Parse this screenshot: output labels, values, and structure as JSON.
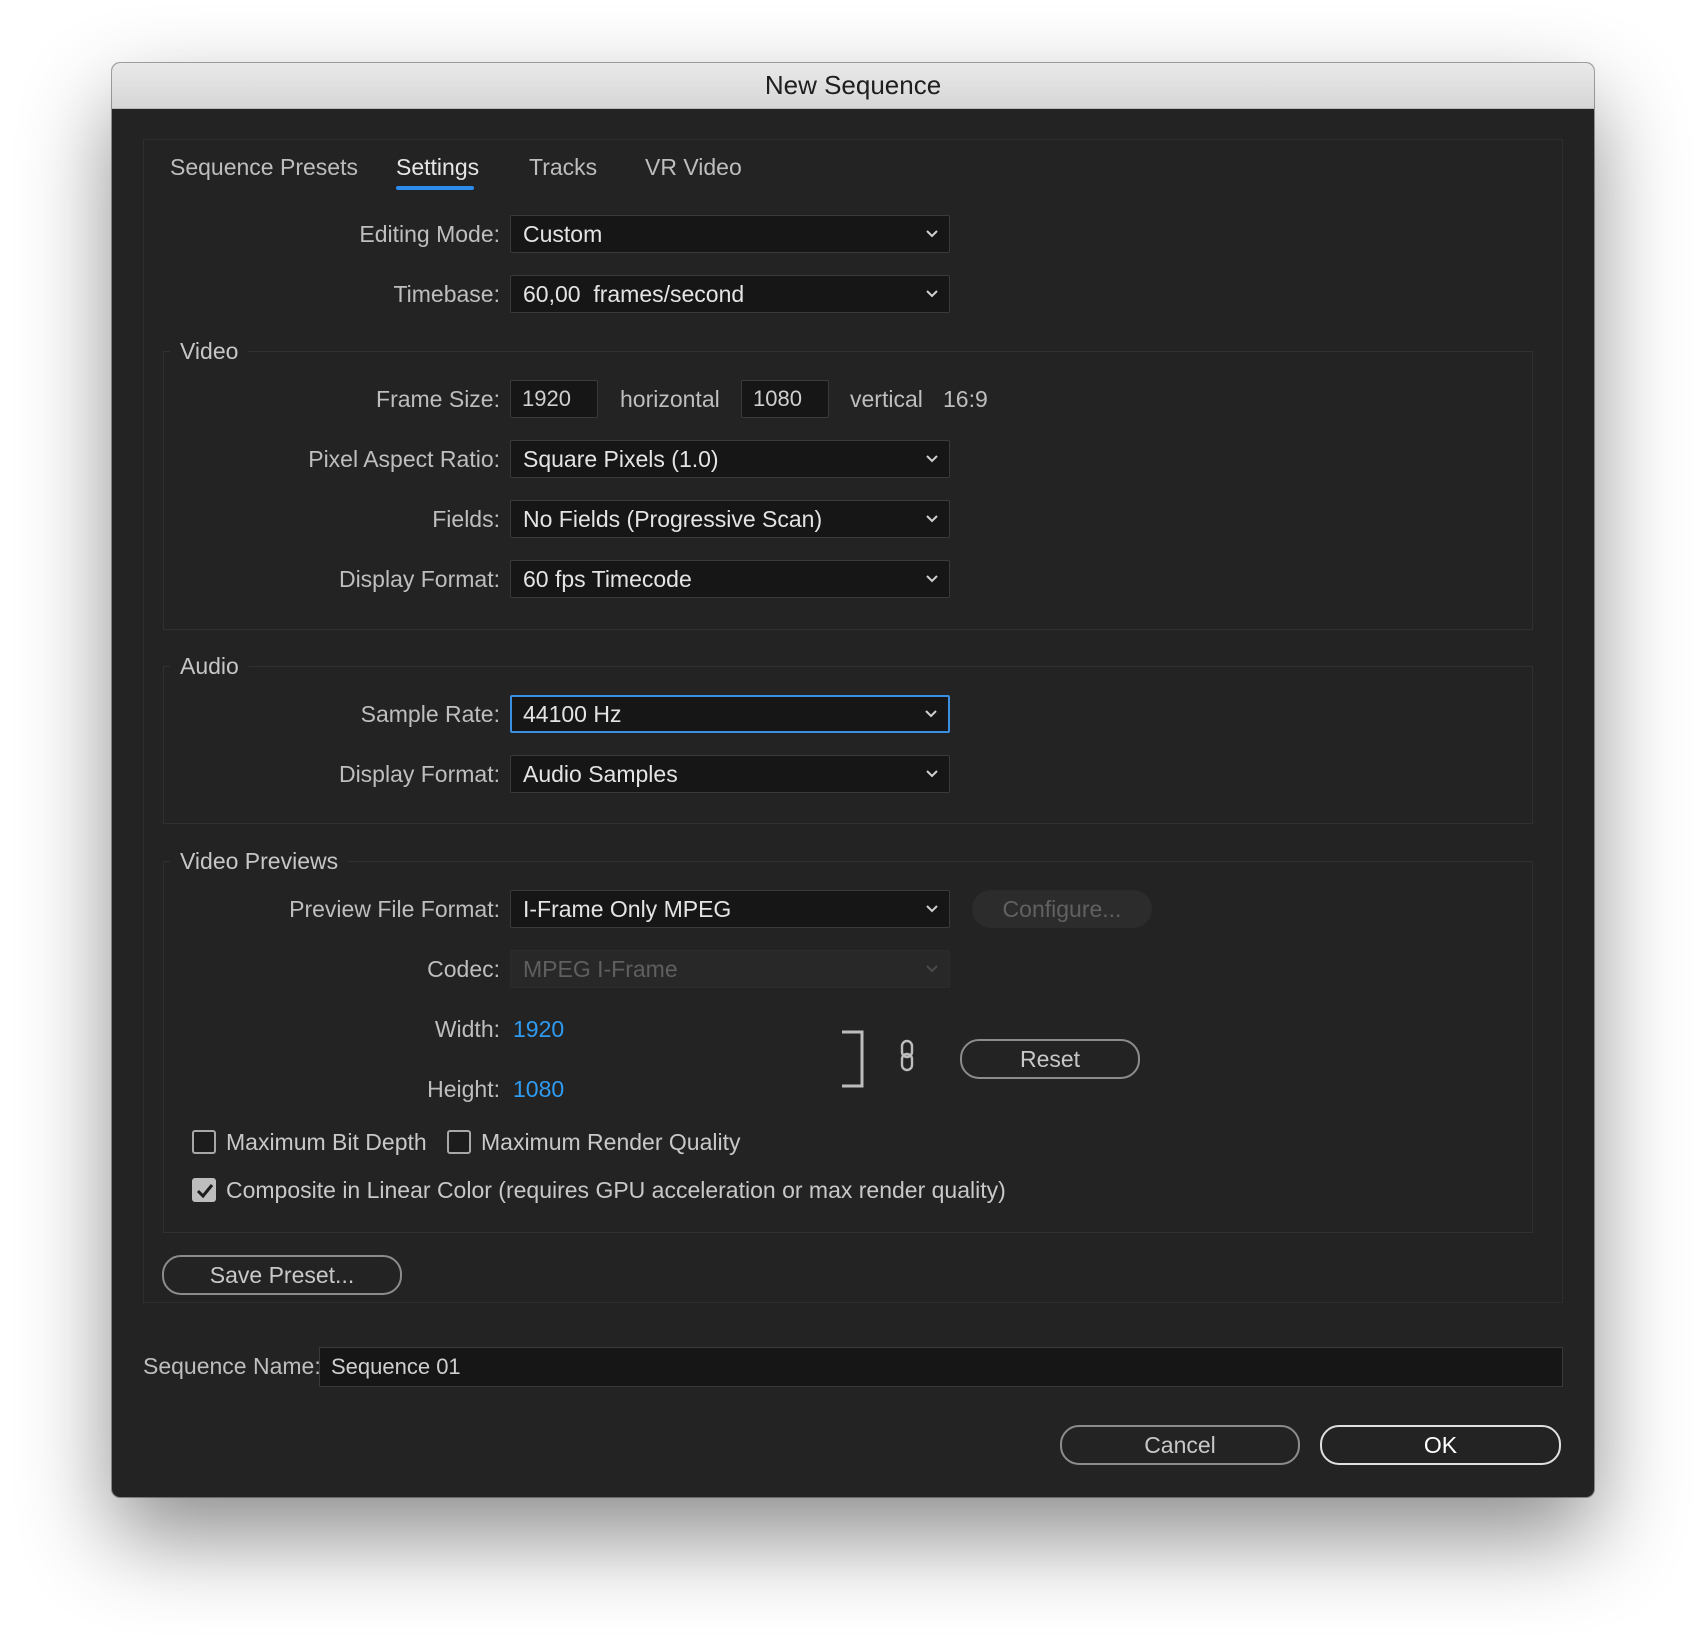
{
  "window": {
    "title": "New Sequence"
  },
  "tabs": [
    {
      "label": "Sequence Presets"
    },
    {
      "label": "Settings",
      "active": true
    },
    {
      "label": "Tracks"
    },
    {
      "label": "VR Video"
    }
  ],
  "general": {
    "editing_mode": {
      "label": "Editing Mode:",
      "value": "Custom"
    },
    "timebase": {
      "label": "Timebase:",
      "value": "60,00  frames/second"
    }
  },
  "video": {
    "title": "Video",
    "frame_size": {
      "label": "Frame Size:",
      "horizontal": "1920",
      "horizontal_label": "horizontal",
      "vertical": "1080",
      "vertical_label": "vertical",
      "ratio": "16:9"
    },
    "pixel_aspect_ratio": {
      "label": "Pixel Aspect Ratio:",
      "value": "Square Pixels (1.0)"
    },
    "fields": {
      "label": "Fields:",
      "value": "No Fields (Progressive Scan)"
    },
    "display_format": {
      "label": "Display Format:",
      "value": "60 fps Timecode"
    }
  },
  "audio": {
    "title": "Audio",
    "sample_rate": {
      "label": "Sample Rate:",
      "value": "44100 Hz"
    },
    "display_format": {
      "label": "Display Format:",
      "value": "Audio Samples"
    }
  },
  "previews": {
    "title": "Video Previews",
    "file_format": {
      "label": "Preview File Format:",
      "value": "I-Frame Only MPEG"
    },
    "configure_label": "Configure...",
    "codec": {
      "label": "Codec:",
      "value": "MPEG I-Frame"
    },
    "width": {
      "label": "Width:",
      "value": "1920"
    },
    "height": {
      "label": "Height:",
      "value": "1080"
    },
    "reset_label": "Reset",
    "max_bit_depth": {
      "label": "Maximum Bit Depth",
      "checked": false
    },
    "max_render_quality": {
      "label": "Maximum Render Quality",
      "checked": false
    },
    "linear_color": {
      "label": "Composite in Linear Color (requires GPU acceleration or max render quality)",
      "checked": true
    }
  },
  "save_preset_label": "Save Preset...",
  "sequence_name": {
    "label": "Sequence Name:",
    "value": "Sequence 01"
  },
  "buttons": {
    "cancel": "Cancel",
    "ok": "OK"
  },
  "colors": {
    "accent": "#2d8ceb",
    "link_value": "#2f9bf0",
    "background": "#232323"
  }
}
